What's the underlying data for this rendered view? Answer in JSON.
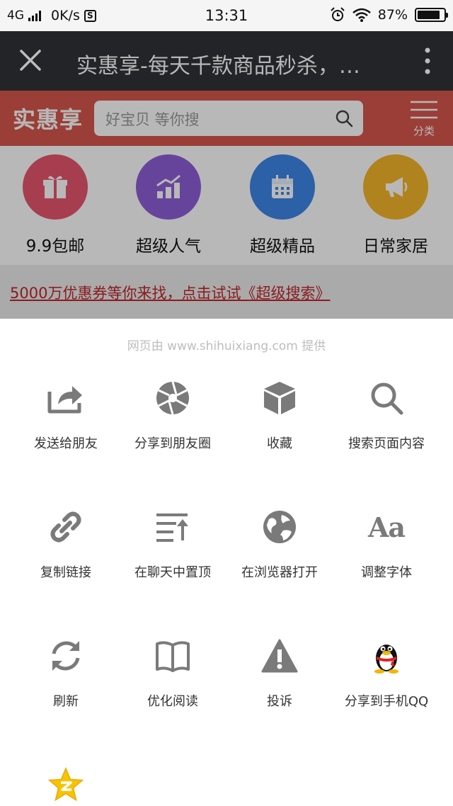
{
  "status_bar": {
    "network": "4G",
    "speed": "0K/s",
    "s_badge": "S",
    "time": "13:31",
    "battery": "87%",
    "battery_level": 0.87
  },
  "title_bar": {
    "page_title": "实惠享-每天千款商品秒杀，…"
  },
  "site": {
    "logo": "实惠享",
    "search_placeholder": "好宝贝 等你搜",
    "menu_label": "分类",
    "categories": [
      {
        "label": "9.9包邮",
        "icon": "gift-icon",
        "color": "#e8566e"
      },
      {
        "label": "超级人气",
        "icon": "chart-icon",
        "color": "#8f5fd8"
      },
      {
        "label": "超级精品",
        "icon": "calendar-icon",
        "color": "#3d86e8"
      },
      {
        "label": "日常家居",
        "icon": "megaphone-icon",
        "color": "#f5b62a"
      }
    ],
    "banner": "5000万优惠券等你来找，点击试试《超级搜索》"
  },
  "sheet": {
    "provided_by": "网页由 www.shihuixiang.com 提供",
    "items": [
      {
        "label": "发送给朋友",
        "icon": "share-send-icon"
      },
      {
        "label": "分享到朋友圈",
        "icon": "moments-shutter-icon"
      },
      {
        "label": "收藏",
        "icon": "favorite-cube-icon"
      },
      {
        "label": "搜索页面内容",
        "icon": "search-icon"
      },
      {
        "label": "复制链接",
        "icon": "link-icon"
      },
      {
        "label": "在聊天中置顶",
        "icon": "pin-top-icon"
      },
      {
        "label": "在浏览器打开",
        "icon": "globe-icon"
      },
      {
        "label": "调整字体",
        "icon": "font-size-icon",
        "glyph": "Aa"
      },
      {
        "label": "刷新",
        "icon": "refresh-icon"
      },
      {
        "label": "优化阅读",
        "icon": "book-icon"
      },
      {
        "label": "投诉",
        "icon": "warning-icon"
      },
      {
        "label": "分享到手机QQ",
        "icon": "qq-penguin-icon"
      },
      {
        "label": "",
        "icon": "qzone-star-icon"
      }
    ]
  },
  "colors": {
    "brand_red": "#d6574d",
    "title_bar_bg": "#222427",
    "icon_gray": "#7a7a7a",
    "banner_link": "#c0262b"
  }
}
